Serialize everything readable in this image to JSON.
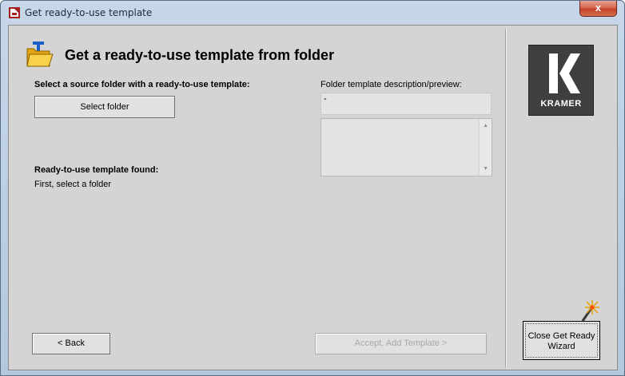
{
  "window": {
    "title": "Get ready-to-use template",
    "close_symbol": "x"
  },
  "header": {
    "title": "Get a ready-to-use template from folder",
    "icon": "template-folder-icon"
  },
  "source": {
    "label": "Select a source folder with a ready-to-use template:",
    "select_button": "Select folder"
  },
  "description": {
    "label": "Folder template description/preview:",
    "value": "-"
  },
  "found": {
    "label": "Ready-to-use template found:",
    "value": "First, select a folder"
  },
  "buttons": {
    "back": "< Back",
    "accept": "Accept, Add Template >",
    "close_wizard_line1": "Close Get Ready",
    "close_wizard_line2": "Wizard"
  },
  "logo": {
    "text": "KRAMER"
  },
  "colors": {
    "dialog_bg": "#d4d4d4",
    "logo_bg": "#3f3f3f",
    "close_button": "#c44128",
    "icon_folder": "#f4c22b",
    "icon_blue": "#1a5fc8"
  }
}
